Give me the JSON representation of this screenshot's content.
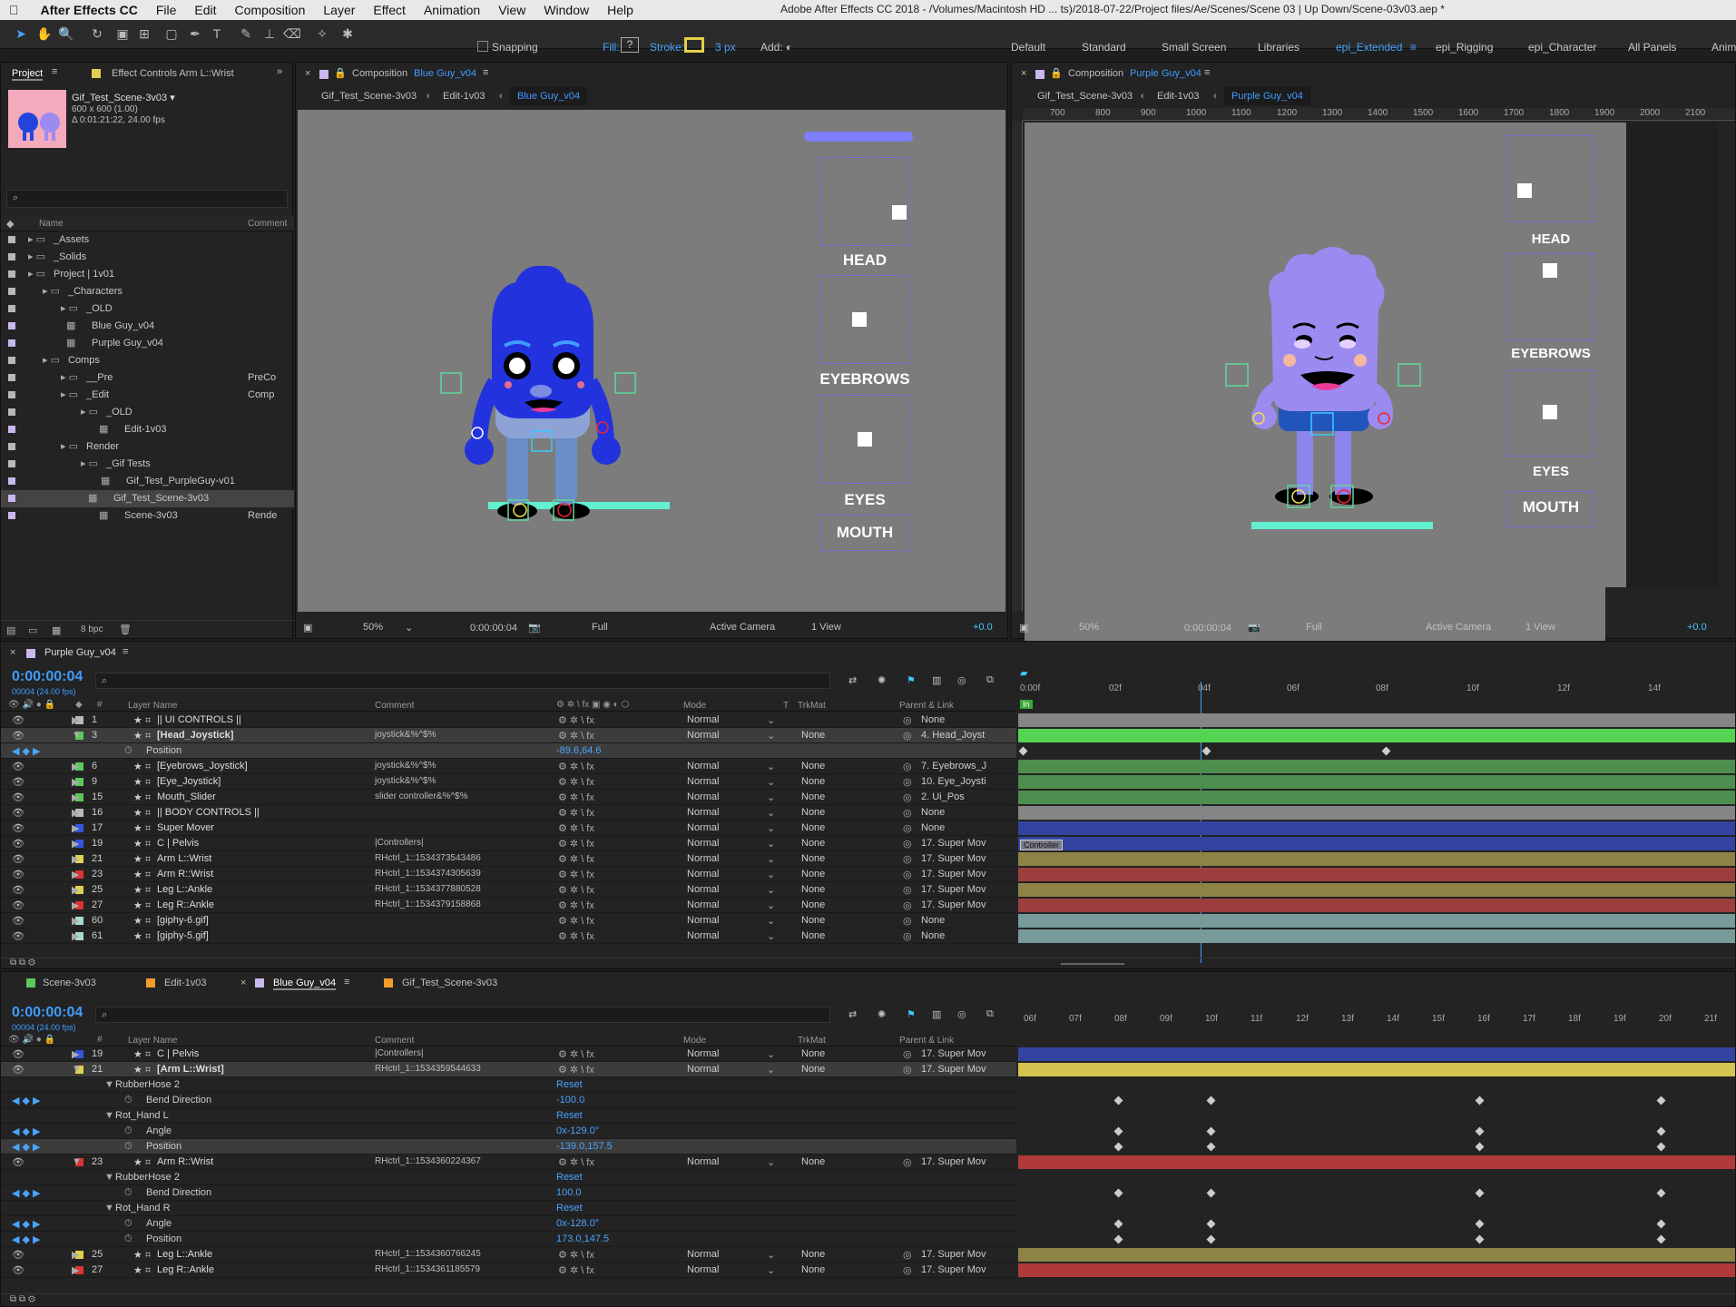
{
  "menubar": {
    "app": "After Effects CC",
    "items": [
      "File",
      "Edit",
      "Composition",
      "Layer",
      "Effect",
      "Animation",
      "View",
      "Window",
      "Help"
    ],
    "doc_title": "Adobe After Effects CC 2018 - /Volumes/Macintosh HD ... ts)/2018-07-22/Project files/Ae/Scenes/Scene 03 | Up Down/Scene-03v03.aep *"
  },
  "toolbar": {
    "snapping": "Snapping",
    "fill": "Fill:",
    "stroke": "Stroke:",
    "stroke_px": "3 px",
    "add": "Add:",
    "workspaces": [
      "Default",
      "Standard",
      "Small Screen",
      "Libraries",
      "epi_Extended",
      "epi_Rigging",
      "epi_Character",
      "All Panels",
      "Anim"
    ]
  },
  "project": {
    "tab": "Project",
    "tab2": "Effect Controls Arm L::Wrist",
    "item": "Gif_Test_Scene-3v03 ▾",
    "info1": "600 x 600 (1.00)",
    "info2": "Δ 0:01:21:22, 24.00 fps",
    "col_name": "Name",
    "col_comment": "Comment",
    "bpc": "8 bpc",
    "items": [
      {
        "name": "_Assets",
        "comment": "",
        "color": "#b8b8b8"
      },
      {
        "name": "_Solids",
        "comment": "",
        "color": "#b8b8b8"
      },
      {
        "name": "Project | 1v01",
        "comment": "",
        "color": "#b8b8b8"
      },
      {
        "name": "_Characters",
        "comment": "",
        "color": "#b8b8b8"
      },
      {
        "name": "_OLD",
        "comment": "",
        "color": "#b8b8b8"
      },
      {
        "name": "Blue Guy_v04",
        "comment": "",
        "color": "#c8b8ee"
      },
      {
        "name": "Purple Guy_v04",
        "comment": "",
        "color": "#c8b8ee"
      },
      {
        "name": "Comps",
        "comment": "",
        "color": "#b8b8b8"
      },
      {
        "name": "__Pre",
        "comment": "PreCo",
        "color": "#b8b8b8"
      },
      {
        "name": "_Edit",
        "comment": "Comp",
        "color": "#b8b8b8"
      },
      {
        "name": "_OLD",
        "comment": "",
        "color": "#b8b8b8"
      },
      {
        "name": "Edit-1v03",
        "comment": "",
        "color": "#c8b8ee"
      },
      {
        "name": "Render",
        "comment": "",
        "color": "#b8b8b8"
      },
      {
        "name": "_Gif Tests",
        "comment": "",
        "color": "#b8b8b8"
      },
      {
        "name": "Gif_Test_PurpleGuy-v01",
        "comment": "",
        "color": "#c8b8ee"
      },
      {
        "name": "Gif_Test_Scene-3v03",
        "comment": "",
        "color": "#c8b8ee"
      },
      {
        "name": "Scene-3v03",
        "comment": "Rende",
        "color": "#c8b8ee"
      }
    ]
  },
  "comp1": {
    "tab": "Composition",
    "name": "Blue Guy_v04",
    "crumbs": [
      "Gif_Test_Scene-3v03",
      "Edit-1v03",
      "Blue Guy_v04"
    ],
    "zoom": "50%",
    "time": "0:00:00:04",
    "res": "Full",
    "camera": "Active Camera",
    "view": "1 View",
    "offset": "+0.0",
    "labels": [
      "HEAD",
      "EYEBROWS",
      "EYES",
      "MOUTH"
    ]
  },
  "comp2": {
    "tab": "Composition",
    "name": "Purple Guy_v04",
    "crumbs": [
      "Gif_Test_Scene-3v03",
      "Edit-1v03",
      "Purple Guy_v04"
    ],
    "zoom": "50%",
    "time": "0:00:00:04",
    "res": "Full",
    "camera": "Active Camera",
    "view": "1 View",
    "offset": "+0.0",
    "labels": [
      "HEAD",
      "EYEBROWS",
      "EYES",
      "MOUTH"
    ],
    "ruler": [
      "700",
      "800",
      "900",
      "1000",
      "1100",
      "1200",
      "1300",
      "1400",
      "1500",
      "1600",
      "1700",
      "1800",
      "1900",
      "2000",
      "2100"
    ]
  },
  "tl1": {
    "tab": "Purple Guy_v04",
    "time": "0:00:00:04",
    "frames": "00004 (24.00 fps)",
    "headers": {
      "name": "Layer Name",
      "comment": "Comment",
      "mode": "Mode",
      "t": "T",
      "trkmat": "TrkMat",
      "parent": "Parent & Link"
    },
    "ticks": [
      "0:00f",
      "02f",
      "04f",
      "06f",
      "08f",
      "10f",
      "12f",
      "14f"
    ],
    "in": "In",
    "controller": "Controller",
    "rows": [
      {
        "num": "1",
        "name": "|| UI CONTROLS ||",
        "comment": "",
        "mode": "Normal",
        "trk": "",
        "parent": "None",
        "color": "#b8b8b8",
        "bar": "#858585"
      },
      {
        "num": "3",
        "name": "[Head_Joystick]",
        "comment": "joystick&%^$%",
        "mode": "Normal",
        "trk": "None",
        "parent": "4. Head_Joyst",
        "color": "#5cc85c",
        "bar": "#53d453"
      },
      {
        "num": "",
        "name": "Position",
        "comment": "",
        "mode": "",
        "trk": "",
        "parent": "",
        "val": "-89.6,64.6",
        "color": "",
        "bar": ""
      },
      {
        "num": "6",
        "name": "[Eyebrows_Joystick]",
        "comment": "joystick&%^$%",
        "mode": "Normal",
        "trk": "None",
        "parent": "7. Eyebrows_J",
        "color": "#5cc85c",
        "bar": "#4d8d4d"
      },
      {
        "num": "9",
        "name": "[Eye_Joystick]",
        "comment": "joystick&%^$%",
        "mode": "Normal",
        "trk": "None",
        "parent": "10. Eye_Joysti",
        "color": "#5cc85c",
        "bar": "#4d8d4d"
      },
      {
        "num": "15",
        "name": "Mouth_Slider",
        "comment": "slider controller&%^$%",
        "mode": "Normal",
        "trk": "None",
        "parent": "2. Ui_Pos",
        "color": "#5cc85c",
        "bar": "#4d8d4d"
      },
      {
        "num": "16",
        "name": "|| BODY CONTROLS ||",
        "comment": "",
        "mode": "Normal",
        "trk": "None",
        "parent": "None",
        "color": "#b8b8b8",
        "bar": "#858585"
      },
      {
        "num": "17",
        "name": "Super Mover",
        "comment": "",
        "mode": "Normal",
        "trk": "None",
        "parent": "None",
        "color": "#3355dd",
        "bar": "#3344a0"
      },
      {
        "num": "19",
        "name": "C | Pelvis",
        "comment": "|Controllers|",
        "mode": "Normal",
        "trk": "None",
        "parent": "17. Super Mov",
        "color": "#3355dd",
        "bar": "#3344a0"
      },
      {
        "num": "21",
        "name": "Arm L::Wrist",
        "comment": "RHctrl_1::1534373543486",
        "mode": "Normal",
        "trk": "None",
        "parent": "17. Super Mov",
        "color": "#e0d050",
        "bar": "#8d8346"
      },
      {
        "num": "23",
        "name": "Arm R::Wrist",
        "comment": "RHctrl_1::1534374305639",
        "mode": "Normal",
        "trk": "None",
        "parent": "17. Super Mov",
        "color": "#dd3333",
        "bar": "#9c3e3e"
      },
      {
        "num": "25",
        "name": "Leg L::Ankle",
        "comment": "RHctrl_1::1534377880528",
        "mode": "Normal",
        "trk": "None",
        "parent": "17. Super Mov",
        "color": "#e0d050",
        "bar": "#8d8346"
      },
      {
        "num": "27",
        "name": "Leg R::Ankle",
        "comment": "RHctrl_1::1534379158868",
        "mode": "Normal",
        "trk": "None",
        "parent": "17. Super Mov",
        "color": "#dd3333",
        "bar": "#9c3e3e"
      },
      {
        "num": "60",
        "name": "[giphy-6.gif]",
        "comment": "",
        "mode": "Normal",
        "trk": "None",
        "parent": "None",
        "color": "#a9d8d8",
        "bar": "#779a9a"
      },
      {
        "num": "61",
        "name": "[giphy-5.gif]",
        "comment": "",
        "mode": "Normal",
        "trk": "None",
        "parent": "None",
        "color": "#a9d8d8",
        "bar": "#779a9a"
      }
    ]
  },
  "tl2": {
    "tabs": [
      "Scene-3v03",
      "Edit-1v03",
      "Blue Guy_v04",
      "Gif_Test_Scene-3v03"
    ],
    "time": "0:00:00:04",
    "frames": "00004 (24.00 fps)",
    "ticks": [
      "06f",
      "07f",
      "08f",
      "09f",
      "10f",
      "11f",
      "12f",
      "13f",
      "14f",
      "15f",
      "16f",
      "17f",
      "18f",
      "19f",
      "20f",
      "21f"
    ],
    "rows": [
      {
        "num": "19",
        "name": "C | Pelvis",
        "comment": "|Controllers|",
        "mode": "Normal",
        "trk": "None",
        "parent": "17. Super Mov",
        "color": "#3355dd",
        "bar": "#3344a0"
      },
      {
        "num": "21",
        "name": "[Arm L::Wrist]",
        "comment": "RHctrl_1::1534359544633",
        "mode": "Normal",
        "trk": "None",
        "parent": "17. Super Mov",
        "color": "#e0d050",
        "bar": "#d4c450"
      },
      {
        "num": "",
        "name": "RubberHose 2",
        "val": "Reset"
      },
      {
        "num": "",
        "name": "Bend Direction",
        "val": "-100.0"
      },
      {
        "num": "",
        "name": "Rot_Hand L",
        "val": "Reset"
      },
      {
        "num": "",
        "name": "Angle",
        "val": "0x-129.0°"
      },
      {
        "num": "",
        "name": "Position",
        "val": "-139.0,157.5"
      },
      {
        "num": "23",
        "name": "Arm R::Wrist",
        "comment": "RHctrl_1::1534360224367",
        "mode": "Normal",
        "trk": "None",
        "parent": "17. Super Mov",
        "color": "#dd3333",
        "bar": "#b03a3a"
      },
      {
        "num": "",
        "name": "RubberHose 2",
        "val": "Reset"
      },
      {
        "num": "",
        "name": "Bend Direction",
        "val": "100.0"
      },
      {
        "num": "",
        "name": "Rot_Hand R",
        "val": "Reset"
      },
      {
        "num": "",
        "name": "Angle",
        "val": "0x-128.0°"
      },
      {
        "num": "",
        "name": "Position",
        "val": "173.0,147.5"
      },
      {
        "num": "25",
        "name": "Leg L::Ankle",
        "comment": "RHctrl_1::1534360766245",
        "mode": "Normal",
        "trk": "None",
        "parent": "17. Super Mov",
        "color": "#e0d050",
        "bar": "#8d8346"
      },
      {
        "num": "27",
        "name": "Leg R::Ankle",
        "comment": "RHctrl_1::1534361185579",
        "mode": "Normal",
        "trk": "None",
        "parent": "17. Super Mov",
        "color": "#dd3333",
        "bar": "#b03a3a"
      }
    ]
  }
}
